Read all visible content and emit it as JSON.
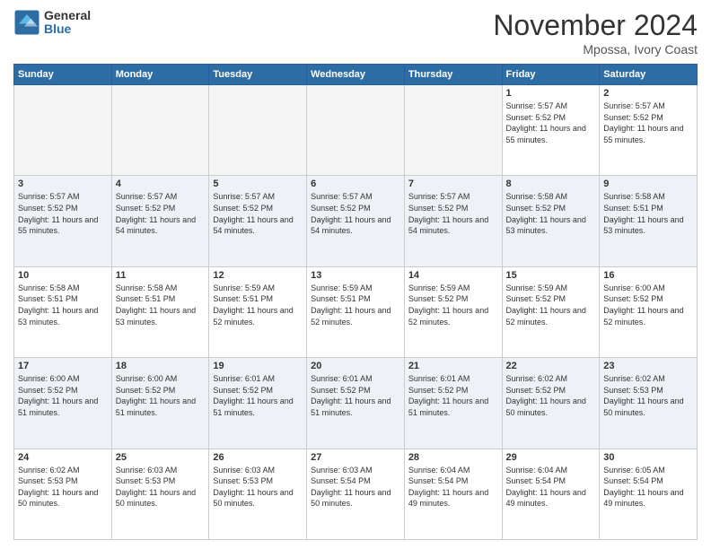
{
  "header": {
    "logo_line1": "General",
    "logo_line2": "Blue",
    "month": "November 2024",
    "location": "Mpossa, Ivory Coast"
  },
  "days_of_week": [
    "Sunday",
    "Monday",
    "Tuesday",
    "Wednesday",
    "Thursday",
    "Friday",
    "Saturday"
  ],
  "weeks": [
    [
      {
        "day": "",
        "empty": true
      },
      {
        "day": "",
        "empty": true
      },
      {
        "day": "",
        "empty": true
      },
      {
        "day": "",
        "empty": true
      },
      {
        "day": "",
        "empty": true
      },
      {
        "day": "1",
        "sunrise": "5:57 AM",
        "sunset": "5:52 PM",
        "daylight": "11 hours and 55 minutes."
      },
      {
        "day": "2",
        "sunrise": "5:57 AM",
        "sunset": "5:52 PM",
        "daylight": "11 hours and 55 minutes."
      }
    ],
    [
      {
        "day": "3",
        "sunrise": "5:57 AM",
        "sunset": "5:52 PM",
        "daylight": "11 hours and 55 minutes."
      },
      {
        "day": "4",
        "sunrise": "5:57 AM",
        "sunset": "5:52 PM",
        "daylight": "11 hours and 54 minutes."
      },
      {
        "day": "5",
        "sunrise": "5:57 AM",
        "sunset": "5:52 PM",
        "daylight": "11 hours and 54 minutes."
      },
      {
        "day": "6",
        "sunrise": "5:57 AM",
        "sunset": "5:52 PM",
        "daylight": "11 hours and 54 minutes."
      },
      {
        "day": "7",
        "sunrise": "5:57 AM",
        "sunset": "5:52 PM",
        "daylight": "11 hours and 54 minutes."
      },
      {
        "day": "8",
        "sunrise": "5:58 AM",
        "sunset": "5:52 PM",
        "daylight": "11 hours and 53 minutes."
      },
      {
        "day": "9",
        "sunrise": "5:58 AM",
        "sunset": "5:51 PM",
        "daylight": "11 hours and 53 minutes."
      }
    ],
    [
      {
        "day": "10",
        "sunrise": "5:58 AM",
        "sunset": "5:51 PM",
        "daylight": "11 hours and 53 minutes."
      },
      {
        "day": "11",
        "sunrise": "5:58 AM",
        "sunset": "5:51 PM",
        "daylight": "11 hours and 53 minutes."
      },
      {
        "day": "12",
        "sunrise": "5:59 AM",
        "sunset": "5:51 PM",
        "daylight": "11 hours and 52 minutes."
      },
      {
        "day": "13",
        "sunrise": "5:59 AM",
        "sunset": "5:51 PM",
        "daylight": "11 hours and 52 minutes."
      },
      {
        "day": "14",
        "sunrise": "5:59 AM",
        "sunset": "5:52 PM",
        "daylight": "11 hours and 52 minutes."
      },
      {
        "day": "15",
        "sunrise": "5:59 AM",
        "sunset": "5:52 PM",
        "daylight": "11 hours and 52 minutes."
      },
      {
        "day": "16",
        "sunrise": "6:00 AM",
        "sunset": "5:52 PM",
        "daylight": "11 hours and 52 minutes."
      }
    ],
    [
      {
        "day": "17",
        "sunrise": "6:00 AM",
        "sunset": "5:52 PM",
        "daylight": "11 hours and 51 minutes."
      },
      {
        "day": "18",
        "sunrise": "6:00 AM",
        "sunset": "5:52 PM",
        "daylight": "11 hours and 51 minutes."
      },
      {
        "day": "19",
        "sunrise": "6:01 AM",
        "sunset": "5:52 PM",
        "daylight": "11 hours and 51 minutes."
      },
      {
        "day": "20",
        "sunrise": "6:01 AM",
        "sunset": "5:52 PM",
        "daylight": "11 hours and 51 minutes."
      },
      {
        "day": "21",
        "sunrise": "6:01 AM",
        "sunset": "5:52 PM",
        "daylight": "11 hours and 51 minutes."
      },
      {
        "day": "22",
        "sunrise": "6:02 AM",
        "sunset": "5:52 PM",
        "daylight": "11 hours and 50 minutes."
      },
      {
        "day": "23",
        "sunrise": "6:02 AM",
        "sunset": "5:53 PM",
        "daylight": "11 hours and 50 minutes."
      }
    ],
    [
      {
        "day": "24",
        "sunrise": "6:02 AM",
        "sunset": "5:53 PM",
        "daylight": "11 hours and 50 minutes."
      },
      {
        "day": "25",
        "sunrise": "6:03 AM",
        "sunset": "5:53 PM",
        "daylight": "11 hours and 50 minutes."
      },
      {
        "day": "26",
        "sunrise": "6:03 AM",
        "sunset": "5:53 PM",
        "daylight": "11 hours and 50 minutes."
      },
      {
        "day": "27",
        "sunrise": "6:03 AM",
        "sunset": "5:54 PM",
        "daylight": "11 hours and 50 minutes."
      },
      {
        "day": "28",
        "sunrise": "6:04 AM",
        "sunset": "5:54 PM",
        "daylight": "11 hours and 49 minutes."
      },
      {
        "day": "29",
        "sunrise": "6:04 AM",
        "sunset": "5:54 PM",
        "daylight": "11 hours and 49 minutes."
      },
      {
        "day": "30",
        "sunrise": "6:05 AM",
        "sunset": "5:54 PM",
        "daylight": "11 hours and 49 minutes."
      }
    ]
  ]
}
